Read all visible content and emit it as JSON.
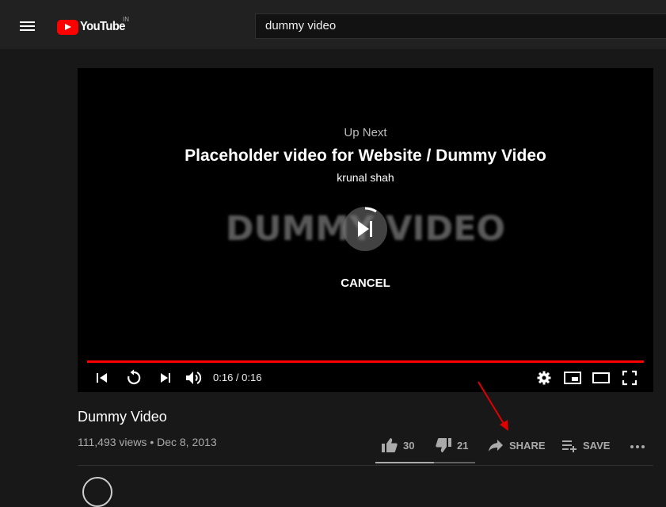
{
  "header": {
    "logo_text": "YouTube",
    "country": "IN",
    "search_value": "dummy video"
  },
  "player": {
    "watermark": "DUMMY VIDEO",
    "up_next_label": "Up Next",
    "next_title": "Placeholder video for Website / Dummy Video",
    "next_channel": "krunal shah",
    "cancel_label": "CANCEL",
    "time": "0:16 / 0:16",
    "progress_fraction": 1.0
  },
  "video": {
    "title": "Dummy Video",
    "meta": "111,493 views • Dec 8, 2013"
  },
  "actions": {
    "likes": "30",
    "dislikes": "21",
    "share_label": "SHARE",
    "save_label": "SAVE",
    "like_ratio": 0.588
  },
  "colors": {
    "accent": "#ff0000",
    "annotation": "#e00000"
  }
}
